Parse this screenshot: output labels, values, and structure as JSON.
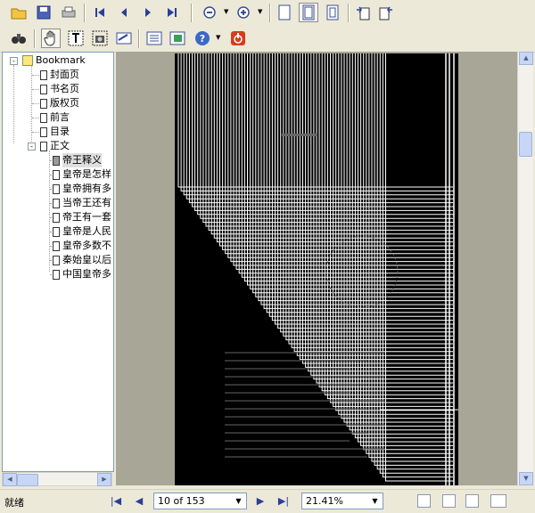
{
  "toolbar1": {
    "icons": [
      "open-folder-icon",
      "save-icon",
      "print-icon",
      "first-page-icon",
      "prev-page-icon",
      "next-page-icon",
      "last-page-icon",
      "zoom-out-icon",
      "zoom-in-icon",
      "single-page-icon",
      "fit-width-icon",
      "fit-page-icon",
      "rotate-left-icon",
      "rotate-right-icon"
    ]
  },
  "toolbar2": {
    "icons": [
      "find-binoculars-icon",
      "hand-tool-icon",
      "text-select-icon",
      "snapshot-icon",
      "highlight-icon",
      "bookmark-panel-icon",
      "thumbnail-panel-icon",
      "help-icon",
      "power-exit-icon"
    ]
  },
  "sidebar": {
    "root": "Bookmark",
    "items": [
      "封面页",
      "书名页",
      "版权页",
      "前言",
      "目录",
      "正文"
    ],
    "children": [
      "帝王释义",
      "皇帝是怎样",
      "皇帝拥有多",
      "当帝王还有",
      "帝王有一套",
      "皇帝是人民",
      "皇帝多数不",
      "秦始皇以后",
      "中国皇帝多"
    ],
    "selected": "帝王释义"
  },
  "status": {
    "text": "就绪",
    "page_field": "10 of 153",
    "zoom_field": "21.41%"
  },
  "colors": {
    "viewport_bg": "#a8a697",
    "chrome_bg": "#ece9d8",
    "accent_blue": "#2a3f9c"
  }
}
